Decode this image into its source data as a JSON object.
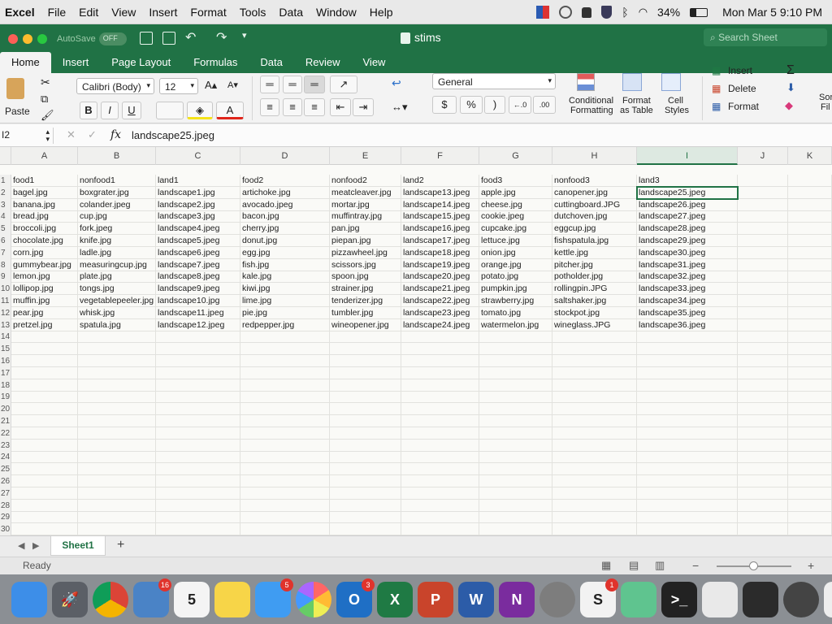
{
  "menubar": {
    "app": "Excel",
    "items": [
      "File",
      "Edit",
      "View",
      "Insert",
      "Format",
      "Tools",
      "Data",
      "Window",
      "Help"
    ],
    "battery": "34%",
    "clock": "Mon Mar 5  9:10 PM"
  },
  "titlebar": {
    "autosave_label": "AutoSave",
    "autosave_state": "OFF",
    "doc_title": "stims",
    "search_placeholder": "Search Sheet"
  },
  "ribbon_tabs": [
    "Home",
    "Insert",
    "Page Layout",
    "Formulas",
    "Data",
    "Review",
    "View"
  ],
  "ribbon": {
    "paste_label": "Paste",
    "font_name": "Calibri (Body)",
    "font_size": "12",
    "bold": "B",
    "italic": "I",
    "underline": "U",
    "number_format": "General",
    "currency": "$",
    "percent": "%",
    "comma": ")",
    "conditional_formatting": [
      "Conditional",
      "Formatting"
    ],
    "format_as_table": [
      "Format",
      "as Table"
    ],
    "cell_styles": [
      "Cell",
      "Styles"
    ],
    "insert_label": "Insert",
    "delete_label": "Delete",
    "format_label": "Format",
    "sort_label": [
      "Sor",
      "Fil"
    ]
  },
  "formula_bar": {
    "name_box": "I2",
    "fx": "fx",
    "formula": "landscape25.jpeg"
  },
  "columns": [
    "A",
    "B",
    "C",
    "D",
    "E",
    "F",
    "G",
    "H",
    "I",
    "J",
    "K"
  ],
  "selected_column": "I",
  "rows": [
    [
      "food1",
      "nonfood1",
      "land1",
      "food2",
      "nonfood2",
      "land2",
      "food3",
      "nonfood3",
      "land3"
    ],
    [
      "bagel.jpg",
      "boxgrater.jpg",
      "landscape1.jpg",
      "artichoke.jpg",
      "meatcleaver.jpg",
      "landscape13.jpeg",
      "apple.jpg",
      "canopener.jpg",
      "landscape25.jpeg"
    ],
    [
      "banana.jpg",
      "colander.jpeg",
      "landscape2.jpg",
      "avocado.jpeg",
      "mortar.jpg",
      "landscape14.jpeg",
      "cheese.jpg",
      "cuttingboard.JPG",
      "landscape26.jpeg"
    ],
    [
      "bread.jpg",
      "cup.jpg",
      "landscape3.jpg",
      "bacon.jpg",
      "muffintray.jpg",
      "landscape15.jpeg",
      "cookie.jpeg",
      "dutchoven.jpg",
      "landscape27.jpeg"
    ],
    [
      "broccoli.jpg",
      "fork.jpeg",
      "landscape4.jpeg",
      "cherry.jpg",
      "pan.jpg",
      "landscape16.jpeg",
      "cupcake.jpg",
      "eggcup.jpg",
      "landscape28.jpeg"
    ],
    [
      "chocolate.jpg",
      "knife.jpg",
      "landscape5.jpeg",
      "donut.jpg",
      "piepan.jpg",
      "landscape17.jpeg",
      "lettuce.jpg",
      "fishspatula.jpg",
      "landscape29.jpeg"
    ],
    [
      "corn.jpg",
      "ladle.jpg",
      "landscape6.jpeg",
      "egg.jpg",
      "pizzawheel.jpg",
      "landscape18.jpeg",
      "onion.jpg",
      "kettle.jpg",
      "landscape30.jpeg"
    ],
    [
      "gummybear.jpg",
      "measuringcup.jpg",
      "landscape7.jpeg",
      "fish.jpg",
      "scissors.jpg",
      "landscape19.jpeg",
      "orange.jpg",
      "pitcher.jpg",
      "landscape31.jpeg"
    ],
    [
      "lemon.jpg",
      "plate.jpg",
      "landscape8.jpeg",
      "kale.jpg",
      "spoon.jpg",
      "landscape20.jpeg",
      "potato.jpg",
      "potholder.jpg",
      "landscape32.jpeg"
    ],
    [
      "lollipop.jpg",
      "tongs.jpg",
      "landscape9.jpeg",
      "kiwi.jpg",
      "strainer.jpg",
      "landscape21.jpeg",
      "pumpkin.jpg",
      "rollingpin.JPG",
      "landscape33.jpeg"
    ],
    [
      "muffin.jpg",
      "vegetablepeeler.jpg",
      "landscape10.jpg",
      "lime.jpg",
      "tenderizer.jpg",
      "landscape22.jpeg",
      "strawberry.jpg",
      "saltshaker.jpg",
      "landscape34.jpeg"
    ],
    [
      "pear.jpg",
      "whisk.jpg",
      "landscape11.jpeg",
      "pie.jpg",
      "tumbler.jpg",
      "landscape23.jpeg",
      "tomato.jpg",
      "stockpot.jpg",
      "landscape35.jpeg"
    ],
    [
      "pretzel.jpg",
      "spatula.jpg",
      "landscape12.jpeg",
      "redpepper.jpg",
      "wineopener.jpg",
      "landscape24.jpeg",
      "watermelon.jpg",
      "wineglass.JPG",
      "landscape36.jpeg"
    ]
  ],
  "row_count": 30,
  "sheet_tabs": [
    "Sheet1"
  ],
  "add_sheet": "+",
  "status": "Ready",
  "dock": [
    {
      "name": "finder",
      "color": "#3d8ee8",
      "glyph": ""
    },
    {
      "name": "launchpad",
      "color": "#5b5f66",
      "glyph": "🚀"
    },
    {
      "name": "chrome",
      "color": "#e0e0e0",
      "glyph": ""
    },
    {
      "name": "mail-bird",
      "color": "#4a83c6",
      "glyph": "",
      "badge": "16"
    },
    {
      "name": "calendar",
      "color": "#f4f4f4",
      "glyph": "5"
    },
    {
      "name": "notes",
      "color": "#f7d548",
      "glyph": ""
    },
    {
      "name": "messages",
      "color": "#3f9cf2",
      "glyph": "",
      "badge": "5"
    },
    {
      "name": "photos",
      "color": "#f2f2f2",
      "glyph": ""
    },
    {
      "name": "outlook",
      "color": "#1f6fc5",
      "glyph": "O",
      "badge": "3"
    },
    {
      "name": "excel",
      "color": "#1f7a44",
      "glyph": "X"
    },
    {
      "name": "powerpoint",
      "color": "#c9442b",
      "glyph": "P"
    },
    {
      "name": "word",
      "color": "#2c5ca8",
      "glyph": "W"
    },
    {
      "name": "onenote",
      "color": "#7a2c9e",
      "glyph": "N"
    },
    {
      "name": "system-preferences",
      "color": "#7d7d7d",
      "glyph": ""
    },
    {
      "name": "slack",
      "color": "#f2f2f2",
      "glyph": "S",
      "badge": "1"
    },
    {
      "name": "atom",
      "color": "#5fc48f",
      "glyph": ""
    },
    {
      "name": "terminal",
      "color": "#222222",
      "glyph": ">_"
    },
    {
      "name": "textedit",
      "color": "#e9e9e9",
      "glyph": ""
    },
    {
      "name": "acrobat",
      "color": "#2b2b2b",
      "glyph": ""
    },
    {
      "name": "screensaver",
      "color": "#444444",
      "glyph": ""
    },
    {
      "name": "documents",
      "color": "#eeeeee",
      "glyph": ""
    },
    {
      "name": "downloads",
      "color": "#dddddd",
      "glyph": ""
    }
  ],
  "colors": {
    "excel_green": "#207245",
    "selection": "#207245"
  }
}
